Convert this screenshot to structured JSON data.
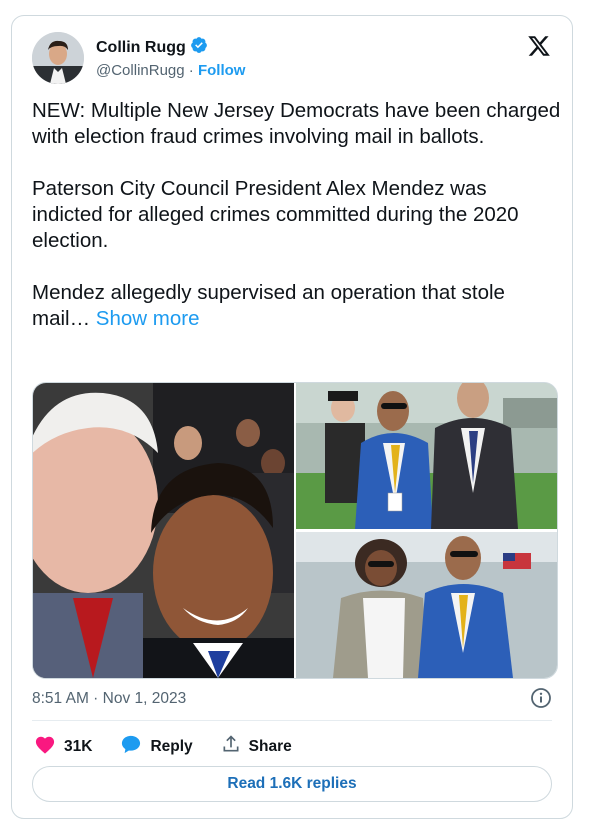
{
  "author": {
    "name": "Collin Rugg",
    "handle": "@CollinRugg",
    "separator": "·",
    "follow_label": "Follow",
    "verified": true
  },
  "icons": {
    "verified": "verified-badge-icon",
    "x_logo": "x-logo-icon",
    "info": "info-icon",
    "like": "heart-icon",
    "reply": "speech-bubble-icon",
    "share": "share-icon"
  },
  "tweet": {
    "paragraph1": "NEW: Multiple New Jersey Democrats have been charged with election fraud crimes involving mail in ballots.",
    "paragraph2": "Paterson City Council President Alex Mendez was indicted for alleged crimes committed during the 2020 election.",
    "paragraph3": "Mendez allegedly supervised an operation that stole mail…",
    "show_more": "Show more"
  },
  "meta": {
    "timestamp": "8:51 AM · Nov 1, 2023"
  },
  "actions": {
    "likes": "31K",
    "reply_label": "Reply",
    "share_label": "Share"
  },
  "read_replies_label": "Read 1.6K replies",
  "colors": {
    "accent": "#1d9bf0",
    "like": "#f91880",
    "text": "#0f1419",
    "secondary": "#536471",
    "border": "#cfd9de"
  }
}
